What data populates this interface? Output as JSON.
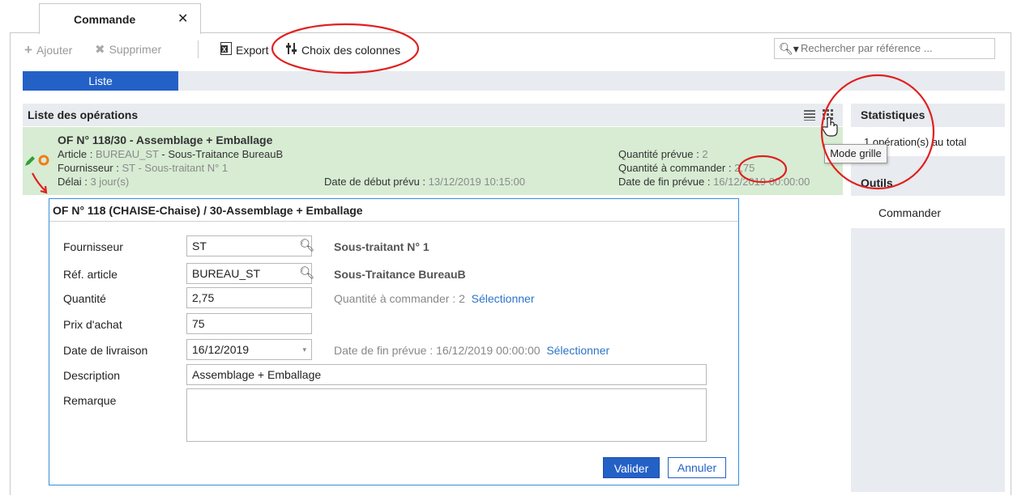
{
  "tab": {
    "label": "Commande",
    "close": "✕"
  },
  "toolbar": {
    "add": "Ajouter",
    "delete": "Supprimer",
    "export": "Export",
    "columns": "Choix des colonnes",
    "search_placeholder": "Rechercher par référence ..."
  },
  "view_tabs": {
    "list": "Liste"
  },
  "panel": {
    "title": "Liste des opérations"
  },
  "operation": {
    "title": "OF N° 118/30 - Assemblage + Emballage",
    "article_label": "Article : ",
    "article_value": "BUREAU_ST",
    "article_desc": " - Sous-Traitance BureauB",
    "supplier_label": "Fournisseur : ",
    "supplier_value": "ST - Sous-traitant N° 1",
    "delay_label": "Délai : ",
    "delay_value": "3 jour(s)",
    "start_label": "Date de début prévu : ",
    "start_value": "13/12/2019 10:15:00",
    "qty_planned_label": "Quantité prévue : ",
    "qty_planned_value": "2",
    "qty_order_label": "Quantité à commander : ",
    "qty_order_value": "2,75",
    "end_label": "Date de fin prévue : ",
    "end_value": "16/12/2019 00:00:00"
  },
  "tooltip": "Mode grille",
  "right": {
    "stats_title": "Statistiques",
    "stats_line": "1 opération(s) au total",
    "tools_title": "Outils",
    "tools_action": "Commander"
  },
  "dialog": {
    "title": "OF N° 118 (CHAISE-Chaise) / 30-Assemblage + Emballage",
    "supplier_label": "Fournisseur",
    "supplier_value": "ST",
    "supplier_desc": "Sous-traitant N° 1",
    "article_label": "Réf. article",
    "article_value": "BUREAU_ST",
    "article_desc": "Sous-Traitance BureauB",
    "qty_label": "Quantité",
    "qty_value": "2,75",
    "qty_hint": "Quantité à commander : 2",
    "select1": "Sélectionner",
    "price_label": "Prix d'achat",
    "price_value": "75",
    "date_label": "Date de livraison",
    "date_value": "16/12/2019",
    "date_hint": "Date de fin prévue : 16/12/2019 00:00:00",
    "select2": "Sélectionner",
    "desc_label": "Description",
    "desc_value": "Assemblage + Emballage",
    "remark_label": "Remarque",
    "remark_value": "",
    "ok": "Valider",
    "cancel": "Annuler"
  },
  "colors": {
    "accent": "#2461c7",
    "row_highlight": "#d7ecd3",
    "annotation": "#e02020",
    "link": "#2a74c9"
  }
}
